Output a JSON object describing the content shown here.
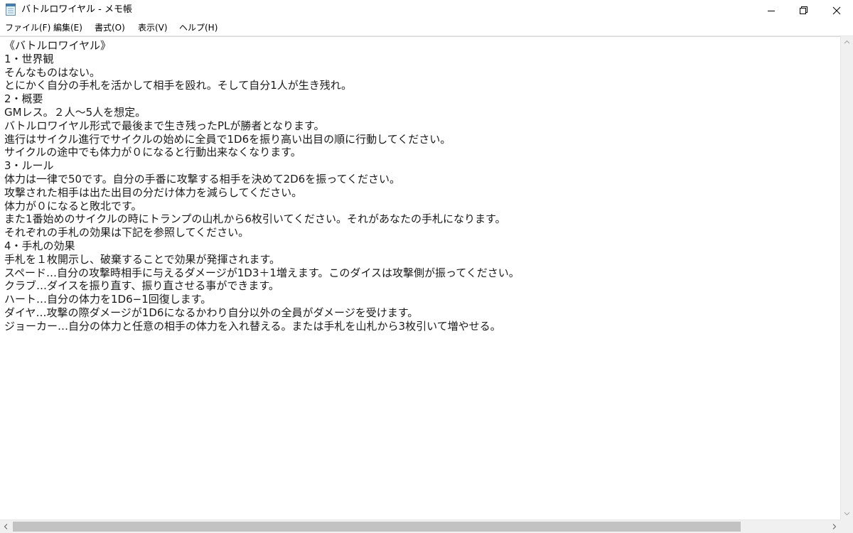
{
  "window": {
    "title": "バトルロワイヤル - メモ帳"
  },
  "menu": [
    {
      "label": "ファイル(F)"
    },
    {
      "label": "編集(E)"
    },
    {
      "label": "書式(O)"
    },
    {
      "label": "表示(V)"
    },
    {
      "label": "ヘルプ(H)"
    }
  ],
  "document": {
    "lines": [
      "《バトルロワイヤル》",
      "1・世界観",
      "そんなものはない。",
      "とにかく自分の手札を活かして相手を殴れ。そして自分1人が生き残れ。",
      "2・概要",
      "GMレス。２人〜5人を想定。",
      "バトルロワイヤル形式で最後まで生き残ったPLが勝者となります。",
      "進行はサイクル進行でサイクルの始めに全員で1D6を振り高い出目の順に行動してください。",
      "サイクルの途中でも体力が０になると行動出来なくなります。",
      "3・ルール",
      "体力は一律で50です。自分の手番に攻撃する相手を決めて2D6を振ってください。",
      "攻撃された相手は出た出目の分だけ体力を減らしてください。",
      "体力が０になると敗北です。",
      "また1番始めのサイクルの時にトランプの山札から6枚引いてください。それがあなたの手札になります。",
      "それぞれの手札の効果は下記を参照してください。",
      "4・手札の効果",
      "手札を１枚開示し、破棄することで効果が発揮されます。",
      "スペード…自分の攻撃時相手に与えるダメージが1D3＋1増えます。このダイスは攻撃側が振ってください。",
      "クラブ…ダイスを振り直す、振り直させる事ができます。",
      "ハート…自分の体力を1D6−1回復します。",
      "ダイヤ…攻撃の際ダメージが1D6になるかわり自分以外の全員がダメージを受けます。",
      "ジョーカー…自分の体力と任意の相手の体力を入れ替える。または手札を山札から3枚引いて増やせる。"
    ]
  },
  "icons": {
    "app": "notepad-icon",
    "minimize": "minimize-icon",
    "maximize": "restore-icon",
    "close": "close-icon"
  }
}
